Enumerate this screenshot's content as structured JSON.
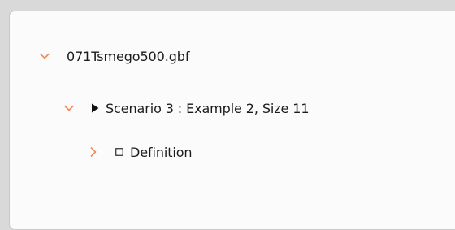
{
  "colors": {
    "chevron": "#f08a5d",
    "text": "#1b1b1b",
    "panel_background": "#fbfbfb",
    "window_background": "#d9d9d9"
  },
  "tree": {
    "items": [
      {
        "label": "071Tsmego500.gbf",
        "expanded": true,
        "icon": "chevron-down-icon"
      },
      {
        "label": "Scenario 3 : Example 2, Size 11",
        "expanded": true,
        "icon": "chevron-down-icon",
        "marker": "play-triangle-icon"
      },
      {
        "label": "Definition",
        "expanded": false,
        "icon": "chevron-right-icon",
        "marker": "checkbox-empty-icon"
      }
    ]
  }
}
